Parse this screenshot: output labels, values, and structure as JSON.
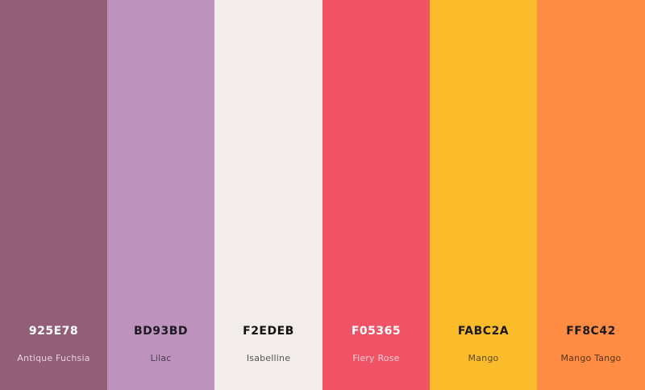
{
  "palette": {
    "swatches": [
      {
        "hex": "925E78",
        "name": "Antique Fuchsia",
        "color": "#925E78",
        "hex_color": "#FFFFFF",
        "name_color": "#E4D3DC"
      },
      {
        "hex": "BD93BD",
        "name": "Lilac",
        "color": "#BD93BD",
        "hex_color": "#1F1A22",
        "name_color": "#4A3C50"
      },
      {
        "hex": "F2EDEB",
        "name": "Isabelline",
        "color": "#F2EDEB",
        "hex_color": "#111111",
        "name_color": "#555555"
      },
      {
        "hex": "F05365",
        "name": "Fiery Rose",
        "color": "#F05365",
        "hex_color": "#FFFFFF",
        "name_color": "#FBD0D5"
      },
      {
        "hex": "FABC2A",
        "name": "Mango",
        "color": "#FABC2A",
        "hex_color": "#1A1A1A",
        "name_color": "#5A4A20"
      },
      {
        "hex": "FF8C42",
        "name": "Mango Tango",
        "color": "#FF8C42",
        "hex_color": "#1A1A1A",
        "name_color": "#5A3518"
      }
    ]
  }
}
